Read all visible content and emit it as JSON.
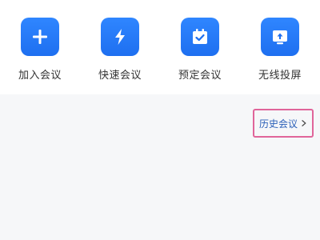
{
  "actions": [
    {
      "label": "加入会议",
      "icon": "plus-icon"
    },
    {
      "label": "快速会议",
      "icon": "lightning-icon"
    },
    {
      "label": "预定会议",
      "icon": "calendar-check-icon"
    },
    {
      "label": "无线投屏",
      "icon": "screen-cast-icon"
    }
  ],
  "history": {
    "label": "历史会议",
    "icon": "chevron-right-icon"
  },
  "colors": {
    "accent": "#1e6ff0",
    "link": "#2a5fb8",
    "highlight": "#e0659a"
  }
}
